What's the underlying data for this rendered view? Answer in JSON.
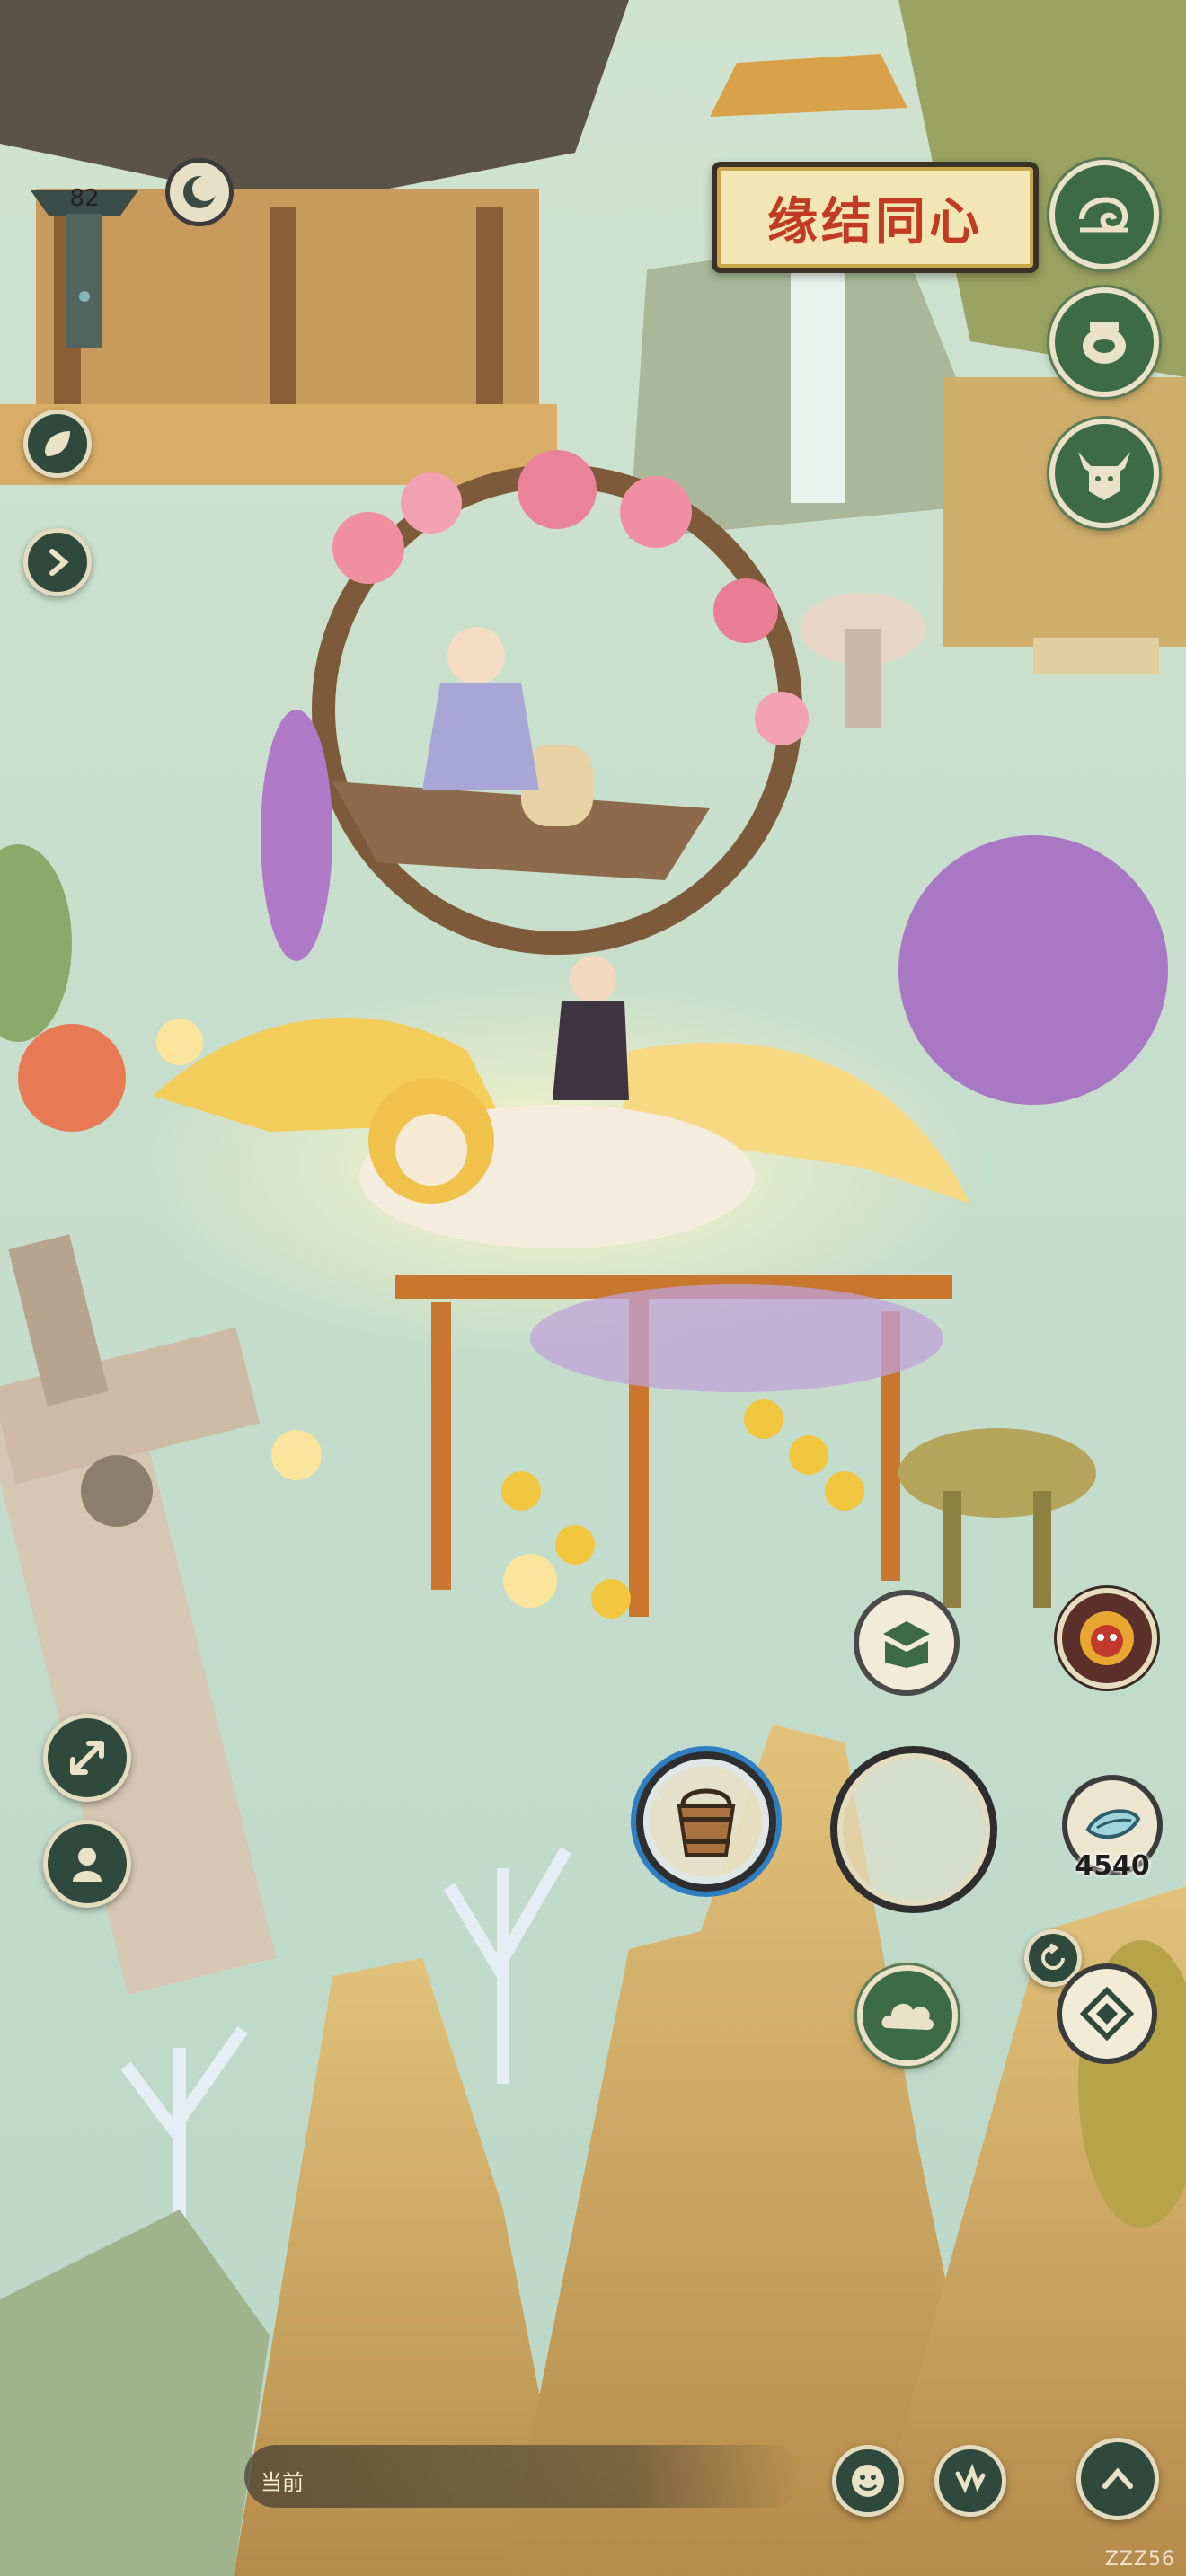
{
  "event_banner": {
    "title": "缘结同心"
  },
  "player": {
    "level": "82"
  },
  "resources": {
    "jade_count": "4540"
  },
  "bottom_bar": {
    "label": "当前"
  },
  "watermark": "ZZZ56",
  "icons": {
    "top_right": [
      "swirl-icon",
      "pot-icon",
      "ox-head-icon"
    ],
    "left": [
      "leaf-icon",
      "expand-arrow-icon"
    ],
    "left_bottom": [
      "move-arrows-icon",
      "person-swap-icon"
    ],
    "action_row": [
      "box-icon",
      "lion-mask-icon"
    ],
    "tools": [
      "bucket-icon",
      "empty-slot-icon",
      "jade-icon"
    ],
    "bottom_right": [
      "refresh-icon",
      "cloud-icon",
      "diamond-icon",
      "emote-icon",
      "gesture-icon",
      "scroll-up-icon"
    ]
  },
  "colors": {
    "button_green": "#3d6b46",
    "ring_blue": "#2f7ec2",
    "banner_red": "#c23a23"
  }
}
